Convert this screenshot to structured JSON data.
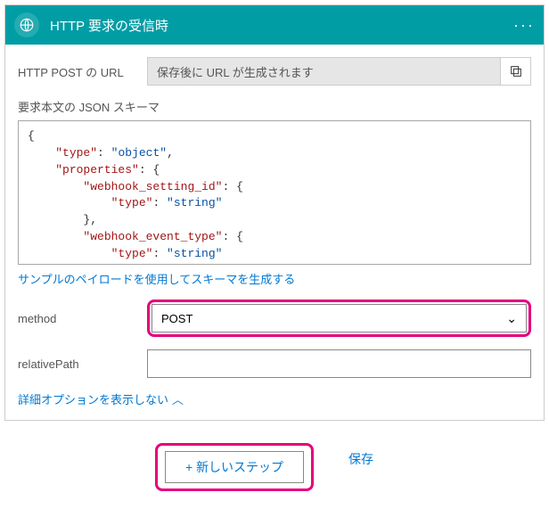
{
  "card": {
    "title": "HTTP 要求の受信時",
    "menu_dots": "···"
  },
  "urlRow": {
    "label": "HTTP POST の URL",
    "value": "保存後に URL が生成されます"
  },
  "schemaSection": {
    "label": "要求本文の JSON スキーマ",
    "jsonTokens": [
      {
        "t": "brace",
        "v": "{"
      },
      {
        "t": "nl"
      },
      {
        "t": "indent",
        "n": 1
      },
      {
        "t": "key",
        "v": "\"type\""
      },
      {
        "t": "colon",
        "v": ": "
      },
      {
        "t": "string",
        "v": "\"object\""
      },
      {
        "t": "plain",
        "v": ","
      },
      {
        "t": "nl"
      },
      {
        "t": "indent",
        "n": 1
      },
      {
        "t": "key",
        "v": "\"properties\""
      },
      {
        "t": "colon",
        "v": ": "
      },
      {
        "t": "brace",
        "v": "{"
      },
      {
        "t": "nl"
      },
      {
        "t": "indent",
        "n": 2
      },
      {
        "t": "key",
        "v": "\"webhook_setting_id\""
      },
      {
        "t": "colon",
        "v": ": "
      },
      {
        "t": "brace",
        "v": "{"
      },
      {
        "t": "nl"
      },
      {
        "t": "indent",
        "n": 3
      },
      {
        "t": "key",
        "v": "\"type\""
      },
      {
        "t": "colon",
        "v": ": "
      },
      {
        "t": "string",
        "v": "\"string\""
      },
      {
        "t": "nl"
      },
      {
        "t": "indent",
        "n": 2
      },
      {
        "t": "brace",
        "v": "},"
      },
      {
        "t": "nl"
      },
      {
        "t": "indent",
        "n": 2
      },
      {
        "t": "key",
        "v": "\"webhook_event_type\""
      },
      {
        "t": "colon",
        "v": ": "
      },
      {
        "t": "brace",
        "v": "{"
      },
      {
        "t": "nl"
      },
      {
        "t": "indent",
        "n": 3
      },
      {
        "t": "key",
        "v": "\"type\""
      },
      {
        "t": "colon",
        "v": ": "
      },
      {
        "t": "string",
        "v": "\"string\""
      },
      {
        "t": "nl"
      },
      {
        "t": "indent",
        "n": 2
      },
      {
        "t": "brace",
        "v": "},"
      }
    ],
    "sampleLink": "サンプルのペイロードを使用してスキーマを生成する"
  },
  "methodRow": {
    "label": "method",
    "value": "POST"
  },
  "relativePathRow": {
    "label": "relativePath",
    "value": ""
  },
  "advancedLink": "詳細オプションを表示しない",
  "footer": {
    "newStep": "+ 新しいステップ",
    "save": "保存"
  }
}
